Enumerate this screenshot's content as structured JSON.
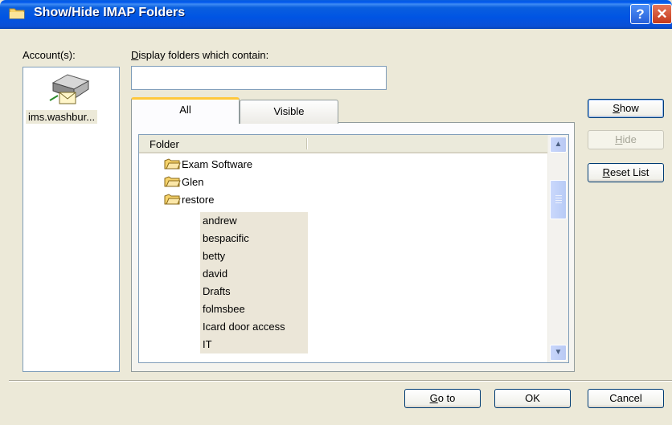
{
  "window": {
    "title": "Show/Hide IMAP Folders"
  },
  "accounts": {
    "label": "Account(s):",
    "items": [
      {
        "name": "ims.washbur..."
      }
    ]
  },
  "filter": {
    "label": "Display folders which contain:",
    "value": ""
  },
  "tabs": [
    {
      "label": "All",
      "selected": true
    },
    {
      "label": "Visible",
      "selected": false
    }
  ],
  "folder_list": {
    "column_header": "Folder",
    "folders": [
      {
        "name": "Exam Software"
      },
      {
        "name": "Glen"
      },
      {
        "name": "restore"
      }
    ],
    "subfolders": [
      "andrew",
      "bespacific",
      "betty",
      "david",
      "Drafts",
      "folmsbee",
      "Icard door access",
      "IT"
    ]
  },
  "buttons": {
    "show": "Show",
    "hide": "Hide",
    "reset": "Reset List",
    "goto": "Go to",
    "ok": "OK",
    "cancel": "Cancel"
  },
  "icons": {
    "title": "folder-icon",
    "account": "mail-server-icon",
    "folder": "subscribed-folder-icon",
    "help": "help-icon",
    "close": "close-icon"
  },
  "colors": {
    "titlebar": "#0054e3",
    "dialog_bg": "#ece9d8",
    "tab_accent": "#ffc83c",
    "close": "#c4391a"
  }
}
